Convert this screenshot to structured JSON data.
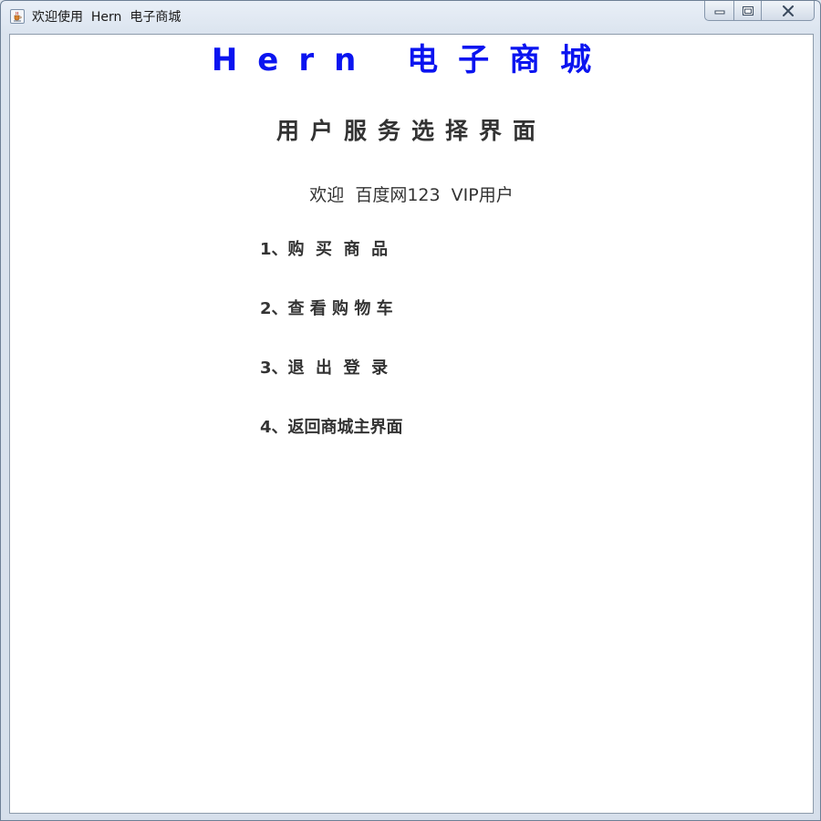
{
  "window": {
    "title": "欢迎使用  Hern  电子商城",
    "icon": "java-cup-icon",
    "caption_buttons": [
      "minimize-icon",
      "maximize-icon",
      "close-icon"
    ]
  },
  "main": {
    "store_title": "Hern 电子商城",
    "page_heading": "用户服务选择界面",
    "welcome_text": "欢迎  百度网123  VIP用户",
    "menu_items": [
      {
        "label": "1、购  买  商  品"
      },
      {
        "label": "2、查 看 购 物 车"
      },
      {
        "label": "3、退  出  登  录"
      },
      {
        "label": "4、返回商城主界面"
      }
    ]
  },
  "colors": {
    "store_title": "#0a14f0",
    "text": "#333333",
    "background": "#ffffff"
  }
}
